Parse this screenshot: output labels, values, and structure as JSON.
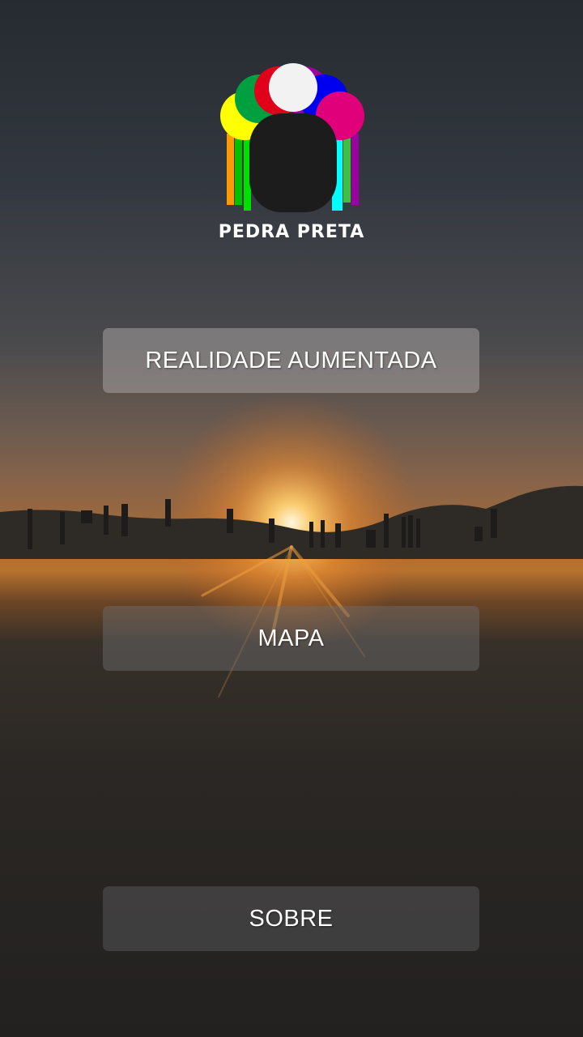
{
  "brand": {
    "name": "PEDRA PRETA",
    "logo": "pedra-preta-logo"
  },
  "menu": {
    "realidade_aumentada": "REALIDADE AUMENTADA",
    "mapa": "MAPA",
    "sobre": "SOBRE"
  },
  "colors": {
    "logo_circles": [
      "#ffff00",
      "#00a040",
      "#e0001a",
      "#f2f2f2",
      "#9b00a0",
      "#0000f0",
      "#e0007a"
    ],
    "logo_head": "#1c1c1c",
    "text": "#ffffff"
  }
}
